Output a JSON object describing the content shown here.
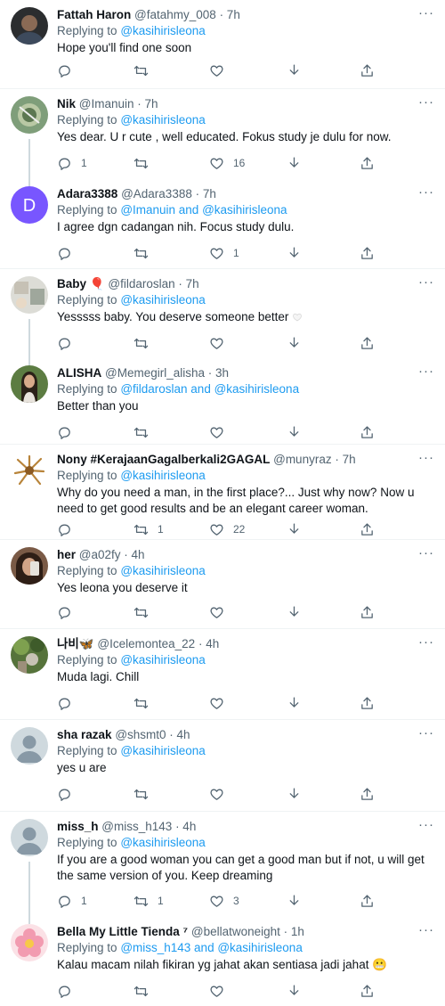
{
  "tweets": [
    {
      "name": "Fattah Haron",
      "badge": "",
      "handle": "@fatahmy_008",
      "time": "· 7h",
      "replying_prefix": "Replying to",
      "mentions": "@kasihirisleona",
      "text": "Hope you'll find one soon",
      "replies": "",
      "retweets": "",
      "likes": "",
      "avatar": "photo-dark"
    },
    {
      "name": "Nik",
      "badge": "",
      "handle": "@Imanuin",
      "time": "· 7h",
      "replying_prefix": "Replying to",
      "mentions": "@kasihirisleona",
      "text": "Yes dear. U r cute , well educated. Fokus study je dulu for now.",
      "replies": "1",
      "retweets": "",
      "likes": "16",
      "avatar": "photo-green"
    },
    {
      "name": "Adara3388",
      "badge": "",
      "handle": "@Adara3388",
      "time": "· 7h",
      "replying_prefix": "Replying to",
      "mentions": "@Imanuin and @kasihirisleona",
      "text": "I agree dgn cadangan nih. Focus study dulu.",
      "replies": "",
      "retweets": "",
      "likes": "1",
      "avatar": "letter-D"
    },
    {
      "name": "Baby",
      "badge": "🎈",
      "handle": "@fildaroslan",
      "time": "· 7h",
      "replying_prefix": "Replying to",
      "mentions": "@kasihirisleona",
      "text": "Yesssss baby. You deserve someone better",
      "replies": "",
      "retweets": "",
      "likes": "",
      "avatar": "photo-light"
    },
    {
      "name": "ALISHA",
      "badge": "",
      "handle": "@Memegirl_alisha",
      "time": "· 3h",
      "replying_prefix": "Replying to",
      "mentions": "@fildaroslan and @kasihirisleona",
      "text": "Better than you",
      "replies": "",
      "retweets": "",
      "likes": "",
      "avatar": "photo-woman"
    },
    {
      "name": "Nony #KerajaanGagalberkali2GAGAL",
      "badge": "",
      "handle": "@munyraz",
      "time": "· 7h",
      "replying_prefix": "Replying to",
      "mentions": "@kasihirisleona",
      "text": "Why do you need a man, in the first place?...    Just why now? Now u need to get good results and be an elegant career woman.",
      "replies": "",
      "retweets": "1",
      "likes": "22",
      "avatar": "photo-creature"
    },
    {
      "name": "her",
      "badge": "",
      "handle": "@a02fy",
      "time": "· 4h",
      "replying_prefix": "Replying to",
      "mentions": "@kasihirisleona",
      "text": "Yes leona you deserve it",
      "replies": "",
      "retweets": "",
      "likes": "",
      "avatar": "photo-selfie"
    },
    {
      "name": "나비🦋",
      "badge": "",
      "handle": "@Icelemontea_22",
      "time": "· 4h",
      "replying_prefix": "Replying to",
      "mentions": "@kasihirisleona",
      "text": "Muda lagi. Chill",
      "replies": "",
      "retweets": "",
      "likes": "",
      "avatar": "photo-tree"
    },
    {
      "name": "sha razak",
      "badge": "",
      "handle": "@shsmt0",
      "time": "· 4h",
      "replying_prefix": "Replying to",
      "mentions": "@kasihirisleona",
      "text": "yes u are",
      "replies": "",
      "retweets": "",
      "likes": "",
      "avatar": "default"
    },
    {
      "name": "miss_h",
      "badge": "",
      "handle": "@miss_h143",
      "time": "· 4h",
      "replying_prefix": "Replying to",
      "mentions": "@kasihirisleona",
      "text": "If you are a good woman you can get a good man but if not, u will get the same version of you. Keep dreaming",
      "replies": "1",
      "retweets": "1",
      "likes": "3",
      "avatar": "default"
    },
    {
      "name": "Bella My Little Tienda ⁷",
      "badge": "",
      "handle": "@bellatwoneight",
      "time": "· 1h",
      "replying_prefix": "Replying to",
      "mentions": "@miss_h143 and @kasihirisleona",
      "text": "Kalau macam nilah fikiran yg jahat akan sentiasa jadi jahat 😬",
      "replies": "",
      "retweets": "",
      "likes": "",
      "avatar": "photo-flower"
    }
  ],
  "more_label": "···",
  "colors": {
    "accent": "#1d9bf0",
    "muted": "#536471",
    "text": "#0f1419",
    "divider": "#eff3f4",
    "avatar_purple": "#7856ff"
  }
}
